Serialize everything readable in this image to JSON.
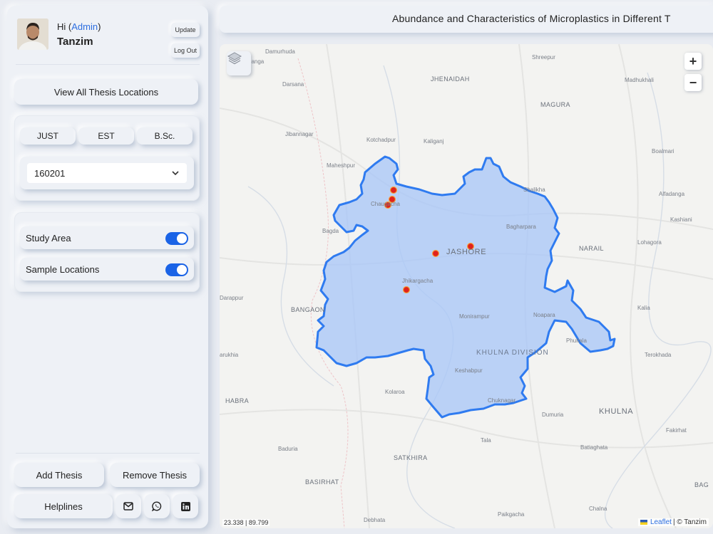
{
  "user": {
    "greeting": "Hi",
    "role": "Admin",
    "name": "Tanzim"
  },
  "header_buttons": {
    "update": "Update",
    "logout": "Log Out"
  },
  "view_all_label": "View All Thesis Locations",
  "filters": {
    "university": "JUST",
    "department": "EST",
    "degree": "B.Sc.",
    "student_id": "160201"
  },
  "layers": [
    {
      "label": "Study Area",
      "enabled": true
    },
    {
      "label": "Sample Locations",
      "enabled": true
    }
  ],
  "actions": {
    "add": "Add Thesis",
    "remove": "Remove Thesis",
    "helplines": "Helplines"
  },
  "contact_icons": [
    "mail-icon",
    "whatsapp-icon",
    "linkedin-icon"
  ],
  "title": "Abundance and Characteristics of Microplastics in Different T",
  "map": {
    "zoom_in": "+",
    "zoom_out": "−",
    "coords": "23.338 | 89.799",
    "attribution_link": "Leaflet",
    "attribution_rest": "| © Tanzim",
    "study_area_fill": "#a9c6f7",
    "study_area_stroke": "#2f7bf0",
    "sample_color": "#e0221b",
    "labels": {
      "damurhuda": "Damurhuda",
      "jhenaidah": "JHENAIDAH",
      "shreepur": "Shreepur",
      "madhukhali": "Madhukhali",
      "darsana": "Darsana",
      "magura": "MAGURA",
      "jibannagar": "Jibannagar",
      "kotchadpur": "Kotchadpur",
      "kaliganj": "Kaliganj",
      "boalmari": "Boalmari",
      "maheshpur": "Maheshpur",
      "shalikha": "Shalikha",
      "alfadanga": "Alfadanga",
      "chaugacha": "Chaugacha",
      "kashiani": "Kashiani",
      "bagda": "Bagda",
      "bagharpara": "Bagharpara",
      "lohagora": "Lohagora",
      "jashore": "JASHORE",
      "narail": "NARAIL",
      "jhikargacha": "Jhikargacha",
      "darappur": "Darappur",
      "bangaon": "BANGAON",
      "kalia": "Kalia",
      "monirampur": "Monirampur",
      "noapara": "Noapara",
      "phultala": "Phultala",
      "khulna_division": "KHULNA DIVISION",
      "terokhada": "Terokhada",
      "barukhia": "arukhia",
      "keshabpur": "Keshabpur",
      "kolaroa": "Kolaroa",
      "habra": "HABRA",
      "dumuria": "Dumuria",
      "khulna": "KHULNA",
      "fakirhat": "Fakirhat",
      "baduria": "Baduria",
      "tala": "Tala",
      "batiaghata": "Batiaghata",
      "satkhira": "SATKHIRA",
      "basirhat": "BASIRHAT",
      "bagerhat": "BAG",
      "debhata": "Debhata",
      "paikgacha": "Paikgacha",
      "chalna": "Chalna",
      "chuknagar": "Chuknagar",
      "danga": "danga"
    }
  }
}
